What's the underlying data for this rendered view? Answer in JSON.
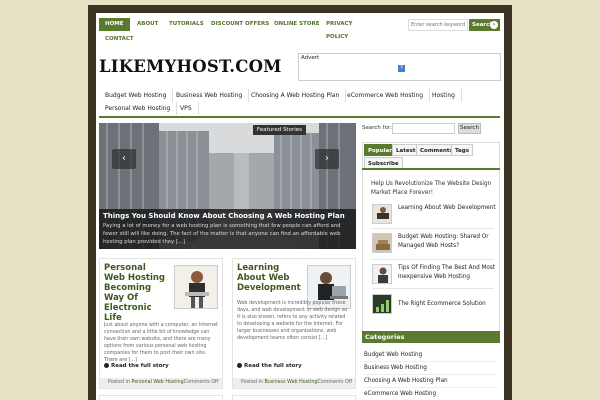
{
  "top_nav": [
    "Home",
    "About",
    "Tutorials",
    "Discount Offers",
    "Online Store",
    "Privacy Policy",
    "Contact"
  ],
  "search_top": {
    "placeholder": "Enter search keyword",
    "button": "Search"
  },
  "site": {
    "logo": "LIKEMYHOST.COM",
    "advert_label": "Advert",
    "advert_icon": "?"
  },
  "categories_nav": [
    "Budget Web Hosting",
    "Business Web Hosting",
    "Choosing A Web Hosting Plan",
    "eCommerce Web Hosting",
    "Hosting",
    "Personal Web Hosting",
    "VPS"
  ],
  "featured": {
    "badge": "Featured Stories",
    "title": "Things You Should Know About Choosing A Web Hosting Plan",
    "excerpt": "Paying a lot of money for a web hosting plan is something that few people can afford and fewer still will like doing. The fact of the matter is that anyone can find an affordable web hosting plan provided they [...]",
    "prev": "‹",
    "next": "›"
  },
  "posts": [
    {
      "title": "Personal Web Hosting Becoming Way Of Electronic Life",
      "excerpt": "Just about anyone with a computer, an Internet connection and a little bit of knowledge can have their own website, and there are many options from various personal web hosting companies for them to post their own site. There are [...]",
      "read_more": "Read the full story",
      "posted_in": "Posted in",
      "category": "Personal Web Hosting",
      "comments": "Comments Off"
    },
    {
      "title": "Learning About Web Development",
      "excerpt": "Web development is incredibly popular these days, and web development or web design as it is also known, refers to any activity related to developing a website for the Internet. For larger businesses and organizations, web development teams often consist [...]",
      "read_more": "Read the full story",
      "posted_in": "Posted in",
      "category": "Business Web Hosting",
      "comments": "Comments Off"
    }
  ],
  "sidebar": {
    "search_label": "Search for:",
    "search_button": "Search",
    "tabs": [
      "Popular",
      "Latest",
      "Comments",
      "Tags",
      "Subscribe"
    ],
    "intro": "Help Us Revolutionize The Website Design Market Place Forever!",
    "popular": [
      "Learning About Web Development",
      "Budget Web Hosting: Shared Or Managed Web Hosts?",
      "Tips Of Finding The Best And Most Inexpensive Web Hosting",
      "The Right Ecommerce Solution"
    ],
    "categories_title": "Categories",
    "categories": [
      "Budget Web Hosting",
      "Business Web Hosting",
      "Choosing A Web Hosting Plan",
      "eCommerce Web Hosting"
    ]
  },
  "colors": {
    "accent": "#5a7a2e",
    "frame": "#3d3322",
    "background": "#e6e2c6"
  }
}
